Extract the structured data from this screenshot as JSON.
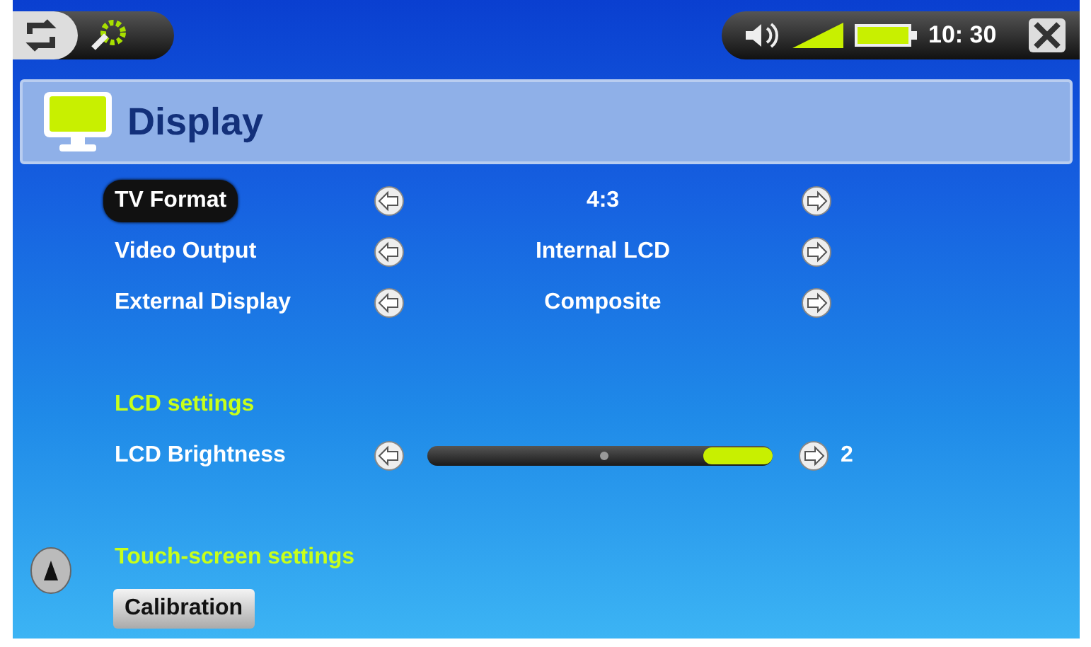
{
  "status_bar": {
    "time": "10: 30"
  },
  "title": "Display",
  "items": [
    {
      "kind": "select",
      "label": "TV Format",
      "selected": true,
      "value": "4:3"
    },
    {
      "kind": "select",
      "label": "Video Output",
      "selected": false,
      "value": "Internal LCD"
    },
    {
      "kind": "select",
      "label": "External Display",
      "selected": false,
      "value": "Composite"
    },
    {
      "kind": "heading",
      "label": "LCD settings"
    },
    {
      "kind": "slider",
      "label": "LCD Brightness",
      "selected": false,
      "level": 0.2,
      "reading": "2"
    },
    {
      "kind": "heading",
      "label": "Touch-screen settings"
    },
    {
      "kind": "button",
      "label": "Calibration"
    }
  ]
}
